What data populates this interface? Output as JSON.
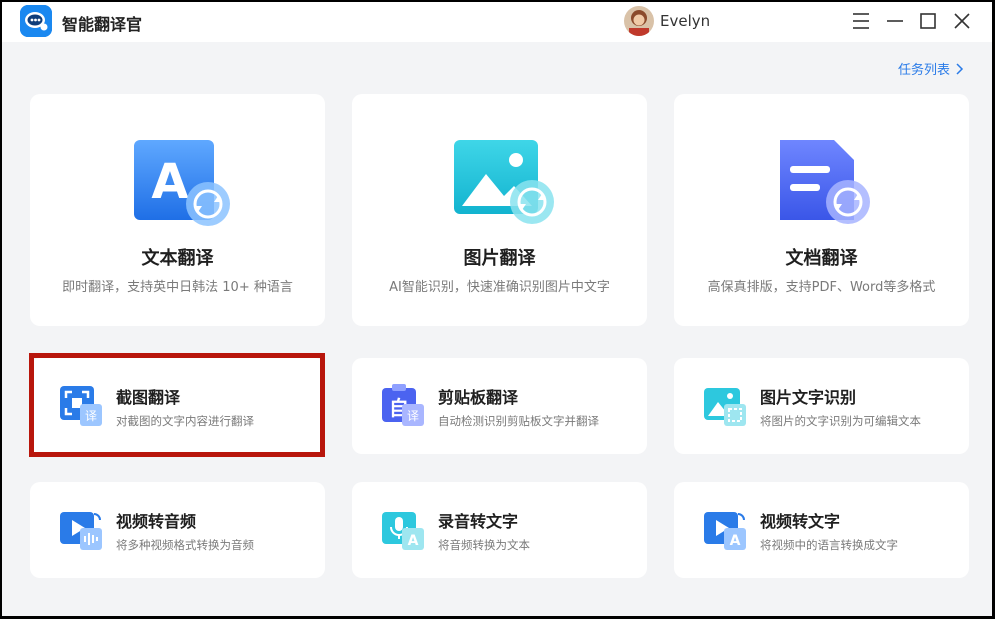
{
  "app": {
    "title": "智能翻译官"
  },
  "user": {
    "name": "Evelyn"
  },
  "window_controls": [
    "menu-icon",
    "minimize-icon",
    "maximize-icon",
    "close-icon"
  ],
  "task_list": {
    "label": "任务列表"
  },
  "main_features": [
    {
      "id": "text",
      "icon": "text-translate-icon",
      "title": "文本翻译",
      "desc": "即时翻译，支持英中日韩法 10+ 种语言"
    },
    {
      "id": "image",
      "icon": "image-translate-icon",
      "title": "图片翻译",
      "desc": "AI智能识别，快速准确识别图片中文字"
    },
    {
      "id": "doc",
      "icon": "document-translate-icon",
      "title": "文档翻译",
      "desc": "高保真排版，支持PDF、Word等多格式"
    }
  ],
  "tools": [
    {
      "id": "screenshot",
      "icon": "screenshot-translate-icon",
      "title": "截图翻译",
      "desc": "对截图的文字内容进行翻译"
    },
    {
      "id": "clipboard",
      "icon": "clipboard-translate-icon",
      "title": "剪贴板翻译",
      "desc": "自动检测识别剪贴板文字并翻译"
    },
    {
      "id": "ocr",
      "icon": "image-ocr-icon",
      "title": "图片文字识别",
      "desc": "将图片的文字识别为可编辑文本"
    },
    {
      "id": "video-audio",
      "icon": "video-to-audio-icon",
      "title": "视频转音频",
      "desc": "将多种视频格式转换为音频"
    },
    {
      "id": "audio-text",
      "icon": "audio-to-text-icon",
      "title": "录音转文字",
      "desc": "将音频转换为文本"
    },
    {
      "id": "video-text",
      "icon": "video-to-text-icon",
      "title": "视频转文字",
      "desc": "将视频中的语言转换成文字"
    }
  ],
  "colors": {
    "accent": "#2a7be8",
    "highlight": "#b8160c",
    "background": "#f3f4f6"
  }
}
